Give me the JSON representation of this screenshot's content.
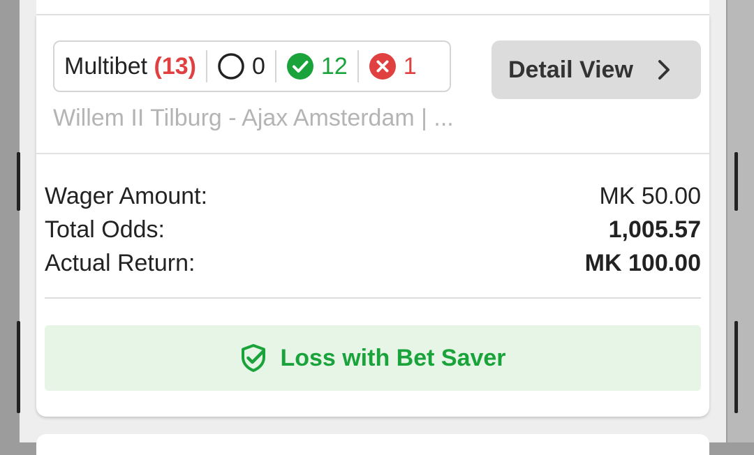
{
  "bet": {
    "type": "Multibet",
    "count": "(13)",
    "stats": {
      "open": "0",
      "won": "12",
      "lost": "1"
    },
    "match": "Willem II Tilburg - Ajax Amsterdam | ..."
  },
  "detail_button": {
    "label": "Detail View"
  },
  "info": {
    "wager_label": "Wager Amount:",
    "wager_value": "MK 50.00",
    "odds_label": "Total Odds:",
    "odds_value": "1,005.57",
    "return_label": "Actual Return:",
    "return_value": "MK 100.00"
  },
  "status": {
    "label": "Loss with Bet Saver",
    "icon": "shield-check-icon"
  },
  "colors": {
    "accent_green": "#1aa33a",
    "accent_red": "#e04040",
    "saver_bg": "#e6f5e6"
  }
}
